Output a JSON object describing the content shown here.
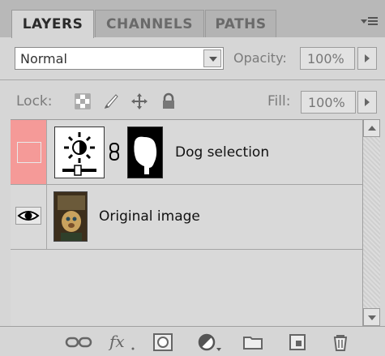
{
  "tabs": [
    {
      "label": "LAYERS",
      "active": true
    },
    {
      "label": "CHANNELS",
      "active": false
    },
    {
      "label": "PATHS",
      "active": false
    }
  ],
  "blend_mode": {
    "value": "Normal"
  },
  "opacity": {
    "label": "Opacity:",
    "value": "100%"
  },
  "lock": {
    "label": "Lock:"
  },
  "fill": {
    "label": "Fill:",
    "value": "100%"
  },
  "layers": [
    {
      "name": "Dog selection",
      "type": "adjustment",
      "visible": false,
      "selected_color": "#f59a98"
    },
    {
      "name": "Original image",
      "type": "pixel",
      "visible": true
    }
  ],
  "bottom_tools": [
    "link-layers-icon",
    "fx-icon",
    "add-mask-icon",
    "adjustment-layer-icon",
    "new-group-icon",
    "new-layer-icon",
    "delete-layer-icon"
  ],
  "colors": {
    "panel": "#d6d6d6",
    "selection": "#f59a98"
  }
}
